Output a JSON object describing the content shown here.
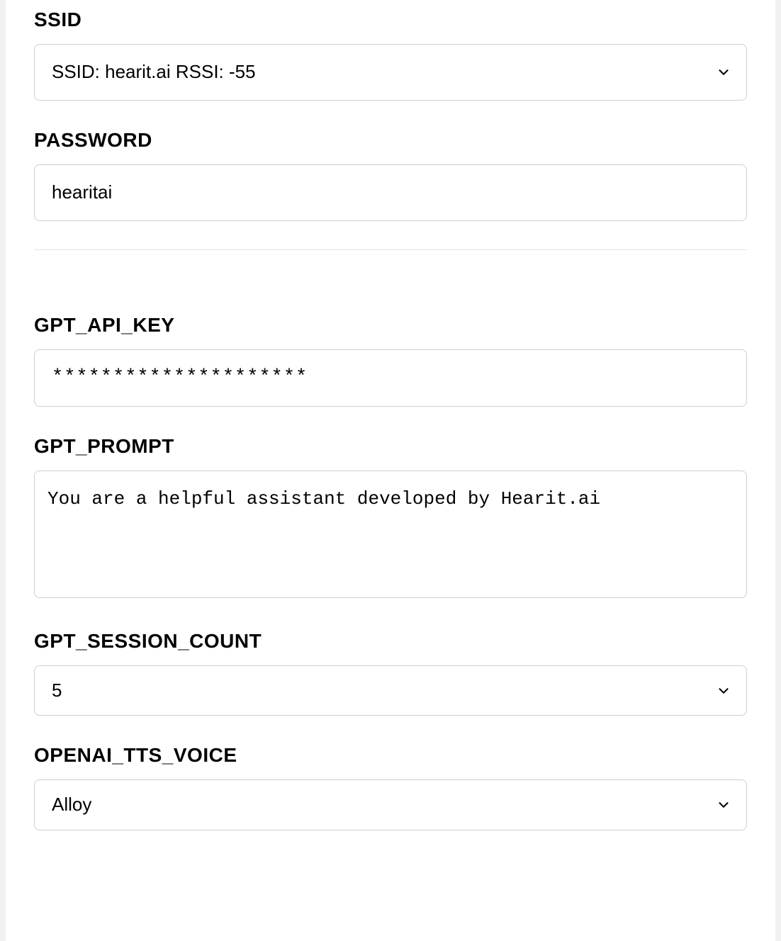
{
  "ssid": {
    "label": "SSID",
    "selected": "SSID: hearit.ai RSSI: -55"
  },
  "password": {
    "label": "PASSWORD",
    "value": "hearitai"
  },
  "gpt_api_key": {
    "label": "GPT_API_KEY",
    "value": "*********************"
  },
  "gpt_prompt": {
    "label": "GPT_PROMPT",
    "value": "You are a helpful assistant developed by Hearit.ai"
  },
  "gpt_session_count": {
    "label": "GPT_SESSION_COUNT",
    "selected": "5"
  },
  "openai_tts_voice": {
    "label": "OPENAI_TTS_VOICE",
    "selected": "Alloy"
  }
}
